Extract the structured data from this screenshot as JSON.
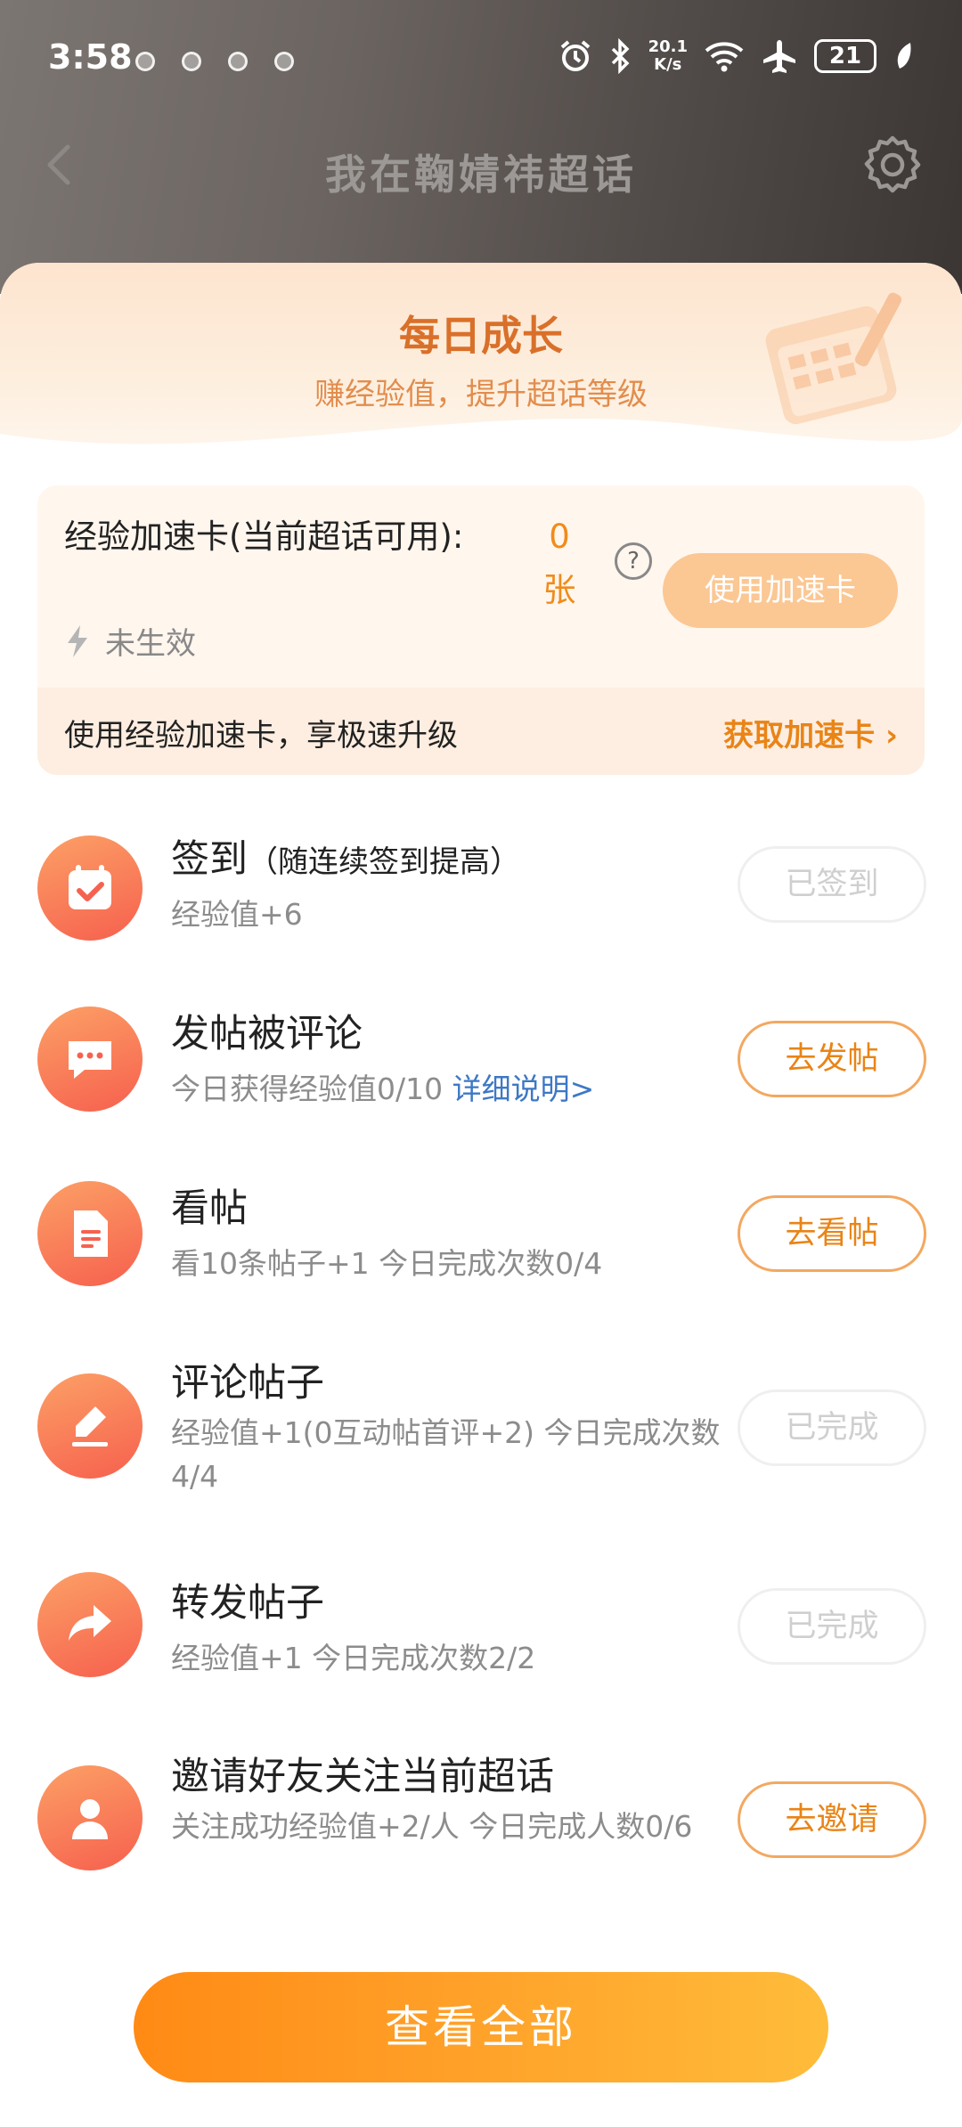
{
  "status_bar": {
    "time": "3:58",
    "net_speed_value": "20.1",
    "net_speed_unit": "K/s",
    "battery": "21"
  },
  "nav": {
    "title": "我在鞠婧祎超话"
  },
  "banner": {
    "title": "每日成长",
    "subtitle": "赚经验值，提升超话等级"
  },
  "accelerate_card": {
    "label": "经验加速卡(当前超话可用):",
    "count": "0张",
    "use_button": "使用加速卡",
    "status": "未生效",
    "promo_text": "使用经验加速卡，享极速升级",
    "get_link": "获取加速卡"
  },
  "tasks": [
    {
      "name": "签到",
      "note": "（随连续签到提高）",
      "desc": "经验值+6",
      "button": "已签到",
      "done": true,
      "icon": "calendar-check-icon"
    },
    {
      "name": "发帖被评论",
      "note": "",
      "desc": "今日获得经验值0/10",
      "link": "详细说明>",
      "button": "去发帖",
      "done": false,
      "icon": "chat-bubble-icon"
    },
    {
      "name": "看帖",
      "note": "",
      "desc": "看10条帖子+1   今日完成次数0/4",
      "button": "去看帖",
      "done": false,
      "icon": "document-icon"
    },
    {
      "name": "评论帖子",
      "note": "",
      "desc": "经验值+1(0互动帖首评+2)  今日完成次数4/4",
      "button": "已完成",
      "done": true,
      "icon": "pencil-icon"
    },
    {
      "name": "转发帖子",
      "note": "",
      "desc": "经验值+1   今日完成次数2/2",
      "button": "已完成",
      "done": true,
      "icon": "share-arrow-icon"
    },
    {
      "name": "邀请好友关注当前超话",
      "note": "",
      "desc": "关注成功经验值+2/人   今日完成人数0/6",
      "button": "去邀请",
      "done": false,
      "icon": "person-icon"
    }
  ],
  "footer": {
    "view_all": "查看全部"
  },
  "colors": {
    "accent": "#f08c1a",
    "link": "#3d78c5",
    "icon_gradient_start": "#fca066",
    "icon_gradient_end": "#f6604e"
  }
}
